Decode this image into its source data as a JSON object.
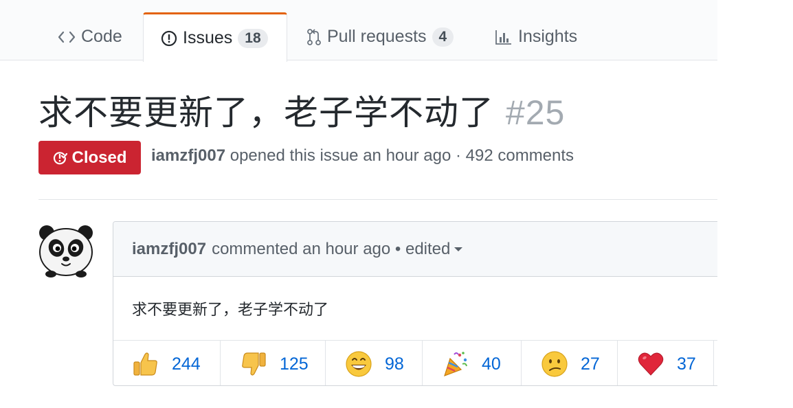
{
  "tabs": [
    {
      "label": "Code",
      "icon": "code-icon"
    },
    {
      "label": "Issues",
      "icon": "issue-opened-icon",
      "counter": "18",
      "selected": true
    },
    {
      "label": "Pull requests",
      "icon": "git-pull-request-icon",
      "counter": "4"
    },
    {
      "label": "Insights",
      "icon": "graph-icon"
    }
  ],
  "issue": {
    "title": "求不要更新了，老子学不动了",
    "number": "#25",
    "state": "Closed",
    "author": "iamzfj007",
    "meta_text": "opened this issue an hour ago · 492 comments"
  },
  "comment": {
    "author": "iamzfj007",
    "header_text": "commented an hour ago • edited",
    "body": "求不要更新了，老子学不动了",
    "avatar": "panda-avatar"
  },
  "reactions": [
    {
      "icon": "thumbs-up-icon",
      "count": "244"
    },
    {
      "icon": "thumbs-down-icon",
      "count": "125"
    },
    {
      "icon": "laugh-icon",
      "count": "98"
    },
    {
      "icon": "hooray-icon",
      "count": "40"
    },
    {
      "icon": "confused-icon",
      "count": "27"
    },
    {
      "icon": "heart-icon",
      "count": "37"
    }
  ],
  "colors": {
    "closed_red": "#cb2431",
    "link_blue": "#0366d6",
    "selected_tab_accent": "#e36209"
  }
}
